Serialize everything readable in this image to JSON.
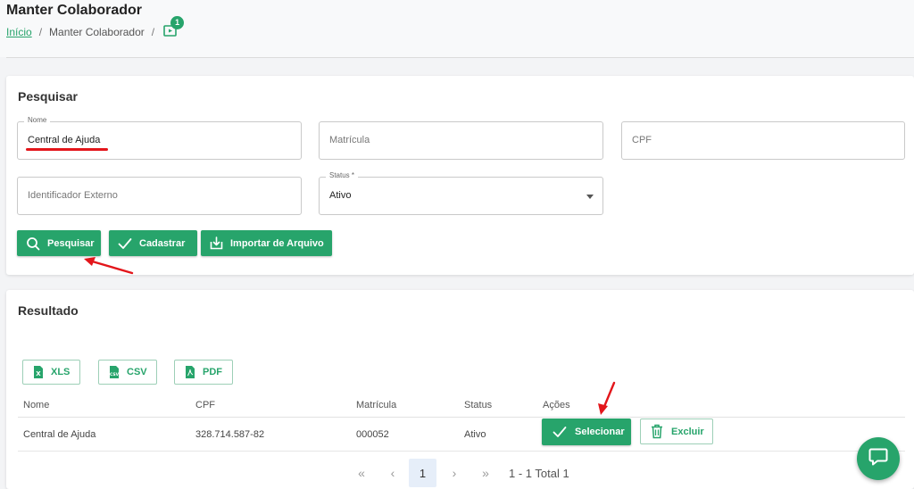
{
  "header": {
    "title": "Manter Colaborador",
    "breadcrumb": {
      "home": "Início",
      "current": "Manter Colaborador",
      "separator": "/",
      "badge_count": "1"
    }
  },
  "search": {
    "title": "Pesquisar",
    "fields": {
      "nome": {
        "label": "Nome",
        "value": "Central de Ajuda"
      },
      "matricula": {
        "placeholder": "Matrícula"
      },
      "cpf": {
        "placeholder": "CPF"
      },
      "identificador": {
        "placeholder": "Identificador Externo"
      },
      "status": {
        "label": "Status *",
        "value": "Ativo"
      }
    },
    "buttons": {
      "pesquisar": "Pesquisar",
      "cadastrar": "Cadastrar",
      "importar": "Importar de Arquivo"
    }
  },
  "result": {
    "title": "Resultado",
    "exports": {
      "xls": "XLS",
      "csv": "CSV",
      "pdf": "PDF"
    },
    "columns": [
      "Nome",
      "CPF",
      "Matrícula",
      "Status",
      "Ações"
    ],
    "rows": [
      {
        "nome": "Central de Ajuda",
        "cpf": "328.714.587-82",
        "matricula": "000052",
        "status": "Ativo"
      }
    ],
    "actions": {
      "selecionar": "Selecionar",
      "excluir": "Excluir"
    },
    "pagination": {
      "first": "«",
      "prev": "‹",
      "current": "1",
      "next": "›",
      "last": "»",
      "total": "1 - 1 Total 1"
    }
  },
  "colors": {
    "accent": "#27a46b",
    "annotation_red": "#e3161b"
  }
}
